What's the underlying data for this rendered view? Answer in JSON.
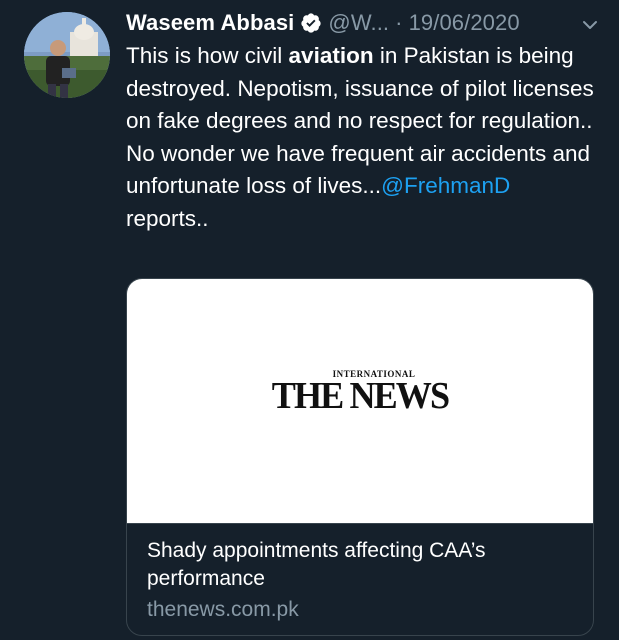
{
  "tweet": {
    "author": {
      "display_name": "Waseem Abbasi",
      "handle": "@W...",
      "verified": true
    },
    "separator": "·",
    "date": "19/06/2020",
    "text_parts": {
      "p1": "This is how civil ",
      "p2_bold": "aviation",
      "p3": " in Pakistan is being destroyed. Nepotism, issuance of pilot licenses on fake degrees and no respect for regulation.. No wonder we have frequent air accidents and unfortunate loss of lives...",
      "mention": "@FrehmanD",
      "p4": " reports.."
    },
    "link_card": {
      "logo_top": "INTERNATIONAL",
      "logo_main": "THE NEWS",
      "title": "Shady appointments affecting CAA’s performance",
      "domain": "thenews.com.pk"
    }
  },
  "colors": {
    "background": "#15202b",
    "text": "#ffffff",
    "muted": "#8899a6",
    "link": "#1da1f2",
    "border": "#38444d"
  },
  "icons": [
    "verified-badge-icon",
    "chevron-down-icon"
  ]
}
